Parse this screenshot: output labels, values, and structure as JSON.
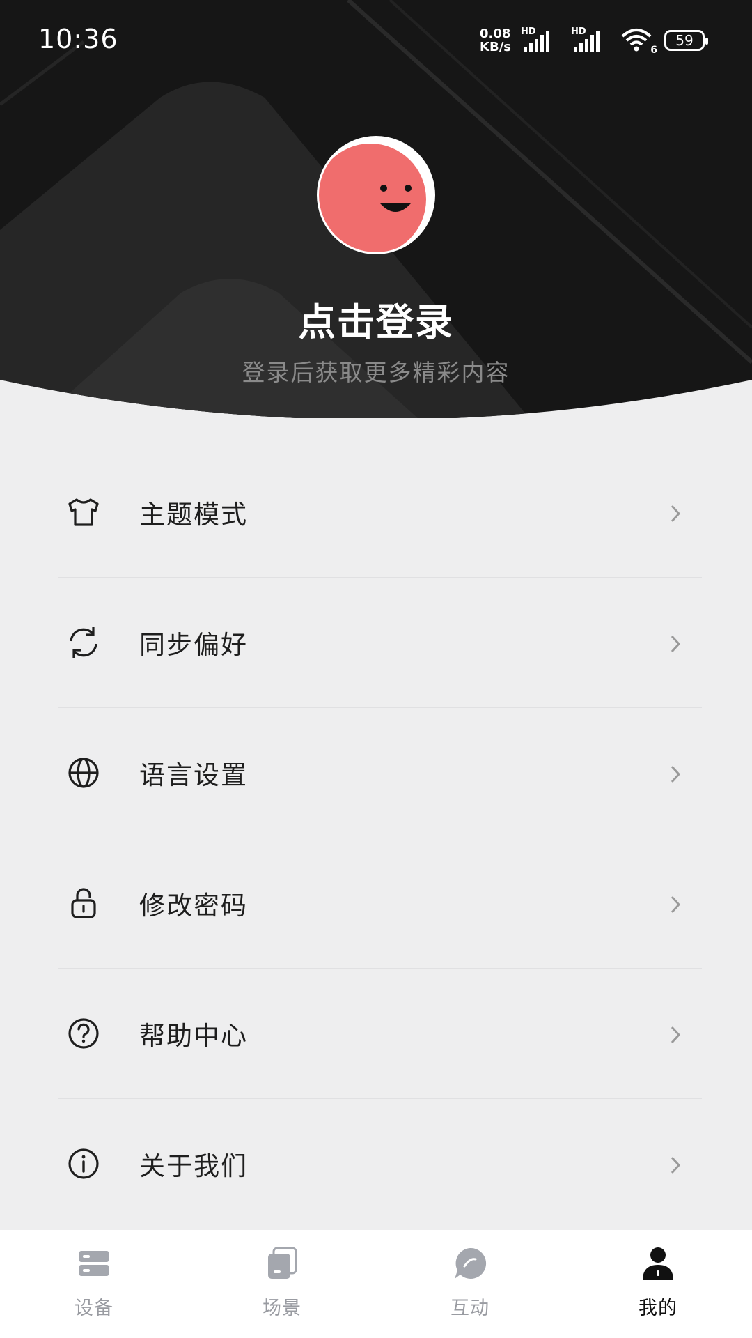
{
  "status_bar": {
    "time": "10:36",
    "net_speed_value": "0.08",
    "net_speed_unit": "KB/s",
    "hd1": "HD",
    "hd2": "HD",
    "wifi_label": "6",
    "battery": "59"
  },
  "profile": {
    "login_title": "点击登录",
    "login_subtitle": "登录后获取更多精彩内容",
    "avatar_color": "#f06d6d"
  },
  "menu": {
    "items": [
      {
        "label": "主题模式",
        "icon": "tshirt-icon"
      },
      {
        "label": "同步偏好",
        "icon": "sync-icon"
      },
      {
        "label": "语言设置",
        "icon": "globe-icon"
      },
      {
        "label": "修改密码",
        "icon": "lock-icon"
      },
      {
        "label": "帮助中心",
        "icon": "help-icon"
      },
      {
        "label": "关于我们",
        "icon": "info-icon"
      }
    ]
  },
  "tabbar": {
    "tabs": [
      {
        "label": "设备",
        "icon": "device-icon",
        "active": false
      },
      {
        "label": "场景",
        "icon": "scene-icon",
        "active": false
      },
      {
        "label": "互动",
        "icon": "chat-icon",
        "active": false
      },
      {
        "label": "我的",
        "icon": "person-icon",
        "active": true
      }
    ]
  },
  "colors": {
    "header_bg": "#1a1a1a",
    "page_bg": "#eeeeef",
    "tab_inactive": "#999ba1",
    "tab_active": "#111111"
  }
}
